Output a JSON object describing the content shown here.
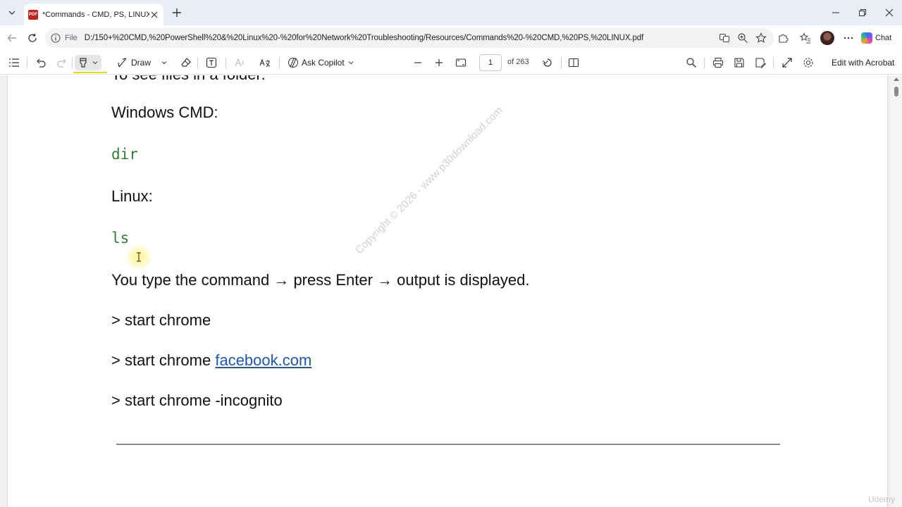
{
  "browser": {
    "tab_title": "*Commands - CMD, PS, LINUX.pdf",
    "pdf_badge": "PDF",
    "address_label": "File",
    "url": "D:/150+%20CMD,%20PowerShell%20&%20Linux%20-%20for%20Network%20Troubleshooting/Resources/Commands%20-%20CMD,%20PS,%20LINUX.pdf",
    "chat_label": "Chat"
  },
  "toolbar": {
    "draw_label": "Draw",
    "ask_copilot_label": "Ask Copilot",
    "page_current": "1",
    "page_total": "of 263",
    "edit_acrobat_label": "Edit with Acrobat"
  },
  "document": {
    "lines": [
      {
        "text": "To see files in a folder:",
        "kind": "text"
      },
      {
        "text": "Windows CMD:",
        "kind": "text"
      },
      {
        "text": "dir",
        "kind": "code"
      },
      {
        "text": "Linux:",
        "kind": "text"
      },
      {
        "text": "ls",
        "kind": "code"
      },
      {
        "text": "You type the command → press Enter → output is displayed.",
        "kind": "text"
      },
      {
        "text": "> start chrome",
        "kind": "text"
      },
      {
        "prefix": "> start chrome ",
        "link": "facebook.com",
        "kind": "link"
      },
      {
        "text": "> start chrome -incognito",
        "kind": "text"
      }
    ],
    "watermark": "Copyright © 2026 - www.p30download.com",
    "corner_mark": "Udemy"
  },
  "colors": {
    "code_green": "#2e7d32",
    "link_blue": "#1a56c4",
    "highlight_yellow": "#f5d800",
    "tab_strip": "#e9eef6"
  }
}
